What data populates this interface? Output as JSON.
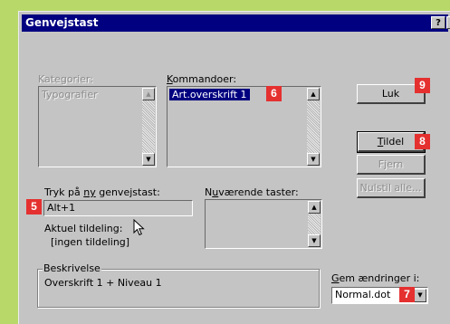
{
  "dialog": {
    "title": "Genvejstast",
    "help_label": "?",
    "close_label": "×"
  },
  "categories": {
    "label": "Kategorier:",
    "items": [
      "Typografier"
    ]
  },
  "commands": {
    "label_prefix": "",
    "label_accel": "K",
    "label_rest": "ommandoer:",
    "items": [
      "Art.overskrift 1"
    ]
  },
  "new_key": {
    "label_prefix": "Tryk på ",
    "label_accel": "ny",
    "label_rest": " genvejstast:",
    "value": "Alt+1"
  },
  "current_keys": {
    "label_prefix": "N",
    "label_accel": "u",
    "label_rest": "værende taster:"
  },
  "assignment": {
    "label": "Aktuel tildeling:",
    "value": "[ingen tildeling]"
  },
  "description": {
    "legend": "Beskrivelse",
    "text": "Overskrift 1 + Niveau 1"
  },
  "save_in": {
    "label_accel": "G",
    "label_rest": "em ændringer i:",
    "value": "Normal.dot"
  },
  "buttons": {
    "close": "Luk",
    "assign_accel": "T",
    "assign_rest": "ildel",
    "remove": "Fjern",
    "reset": "Nulstil alle..."
  },
  "callouts": {
    "close": "9",
    "assign": "8",
    "commands": "6",
    "shortcut": "5",
    "save_in": "7"
  },
  "colors": {
    "titlebar": "#000080",
    "callout": "#e53030",
    "page_accent": "#b8d96a"
  }
}
